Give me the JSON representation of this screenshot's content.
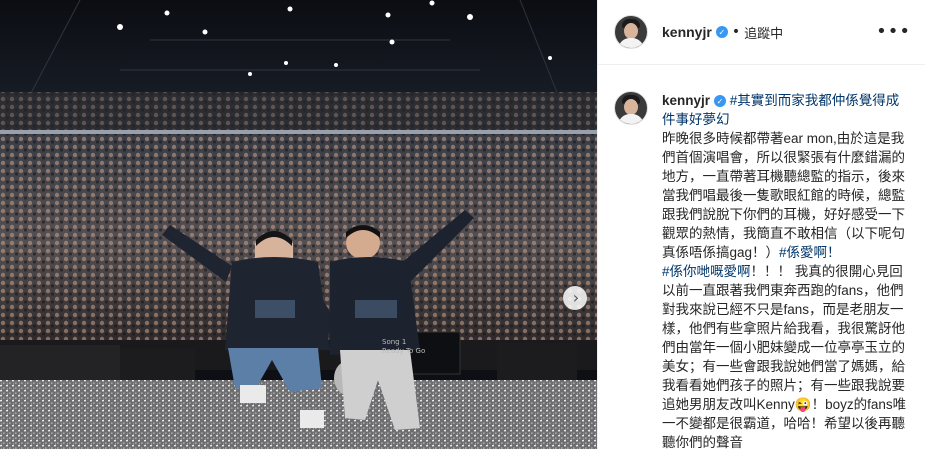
{
  "post": {
    "username": "kennyjr",
    "verified_badge": "✓",
    "separator": "•",
    "follow_label": "追蹤中",
    "more_icon": "•••"
  },
  "caption": {
    "author": "kennyjr",
    "hashtag_1": "#其實到而家我都仲係覺得成件事好夢幻",
    "text_1": "昨晚很多時候都帶著ear mon,由於這是我們首個演唱會，所以很緊張有什麼錯漏的地方，一直帶著耳機聽總監的指示，後來當我們唱最後一隻歌眼紅館的時候，總監跟我們說脫下你們的耳機，好好感受一下觀眾的熱情，我簡直不敢相信（以下呢句真係唔係搞gag！）",
    "hashtag_2": "#係愛啊！",
    "hashtag_3": "#係你哋嘅愛啊",
    "text_2": "！！！ 我真的很開心見回以前一直跟著我們東奔西跑的fans，他們對我來說已經不只是fans，而是老朋友一樣，他們有些拿照片給我看，我很驚訝他們由當年一個小肥妹變成一位亭亭玉立的美女；有一些會跟我說她們當了媽媽，給我看看她們孩子的照片；有一些跟我說要追她男朋友改叫Kenny😜！boyz的fans唯一不變都是很霸道，哈哈！希望以後再聽聽你們的聲音"
  },
  "photo": {
    "stage_screen_line1": "Song 1",
    "stage_screen_line2": "Ready To Go",
    "next_icon": "›"
  },
  "colors": {
    "hashtag": "#003569",
    "verified": "#3897f0",
    "border": "#efefef"
  }
}
